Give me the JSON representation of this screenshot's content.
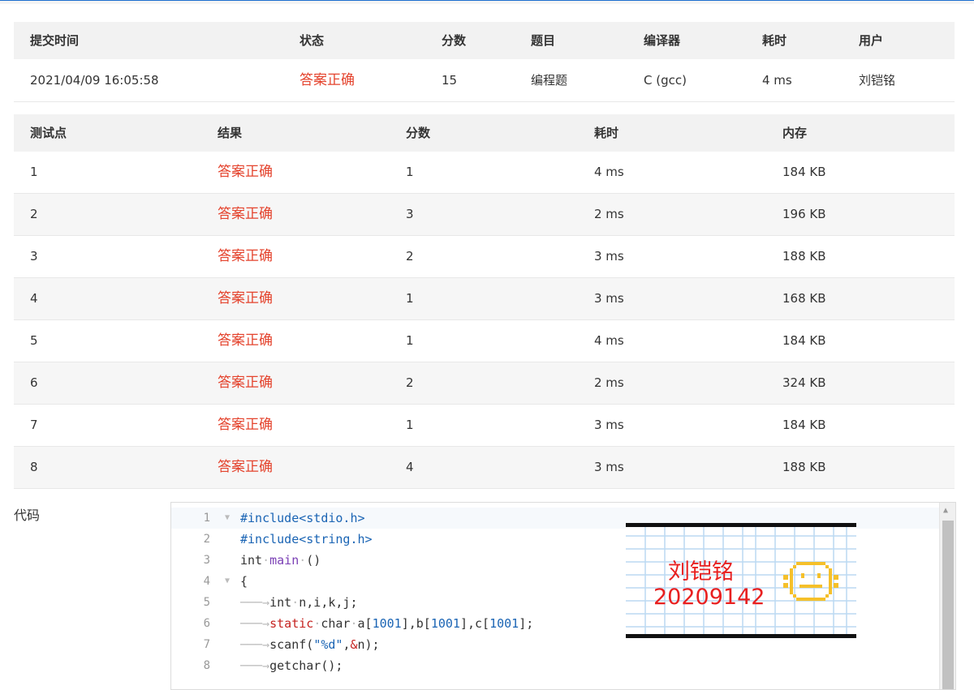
{
  "summary": {
    "headers": [
      "提交时间",
      "状态",
      "分数",
      "题目",
      "编译器",
      "耗时",
      "用户"
    ],
    "row": {
      "time": "2021/04/09 16:05:58",
      "status": "答案正确",
      "score": "15",
      "problem": "编程题",
      "compiler": "C (gcc)",
      "elapsed": "4 ms",
      "user": "刘铠铭"
    }
  },
  "cases": {
    "headers": [
      "测试点",
      "结果",
      "分数",
      "耗时",
      "内存"
    ],
    "rows": [
      {
        "id": "1",
        "result": "答案正确",
        "score": "1",
        "time": "4 ms",
        "memory": "184 KB"
      },
      {
        "id": "2",
        "result": "答案正确",
        "score": "3",
        "time": "2 ms",
        "memory": "196 KB"
      },
      {
        "id": "3",
        "result": "答案正确",
        "score": "2",
        "time": "3 ms",
        "memory": "188 KB"
      },
      {
        "id": "4",
        "result": "答案正确",
        "score": "1",
        "time": "3 ms",
        "memory": "168 KB"
      },
      {
        "id": "5",
        "result": "答案正确",
        "score": "1",
        "time": "4 ms",
        "memory": "184 KB"
      },
      {
        "id": "6",
        "result": "答案正确",
        "score": "2",
        "time": "2 ms",
        "memory": "324 KB"
      },
      {
        "id": "7",
        "result": "答案正确",
        "score": "1",
        "time": "3 ms",
        "memory": "184 KB"
      },
      {
        "id": "8",
        "result": "答案正确",
        "score": "4",
        "time": "3 ms",
        "memory": "188 KB"
      }
    ]
  },
  "code": {
    "label": "代码",
    "lines": [
      {
        "n": "1",
        "fold": true,
        "tokens": [
          {
            "t": "#include<stdio.h>",
            "c": "#1a64b4"
          }
        ]
      },
      {
        "n": "2",
        "fold": false,
        "tokens": [
          {
            "t": "#include<string.h>",
            "c": "#1a64b4"
          }
        ]
      },
      {
        "n": "3",
        "fold": false,
        "tokens": [
          {
            "t": "int",
            "c": "#333333"
          },
          {
            "t": "·",
            "c": "#bbbbbb"
          },
          {
            "t": "main",
            "c": "#7a3fb5"
          },
          {
            "t": "·",
            "c": "#bbbbbb"
          },
          {
            "t": "()",
            "c": "#333333"
          }
        ]
      },
      {
        "n": "4",
        "fold": true,
        "tokens": [
          {
            "t": "{",
            "c": "#333333"
          }
        ]
      },
      {
        "n": "5",
        "fold": false,
        "tokens": [
          {
            "t": "───→",
            "c": "#bbbbbb"
          },
          {
            "t": "int",
            "c": "#333333"
          },
          {
            "t": "·",
            "c": "#bbbbbb"
          },
          {
            "t": "n,i,k,j;",
            "c": "#333333"
          }
        ]
      },
      {
        "n": "6",
        "fold": false,
        "tokens": [
          {
            "t": "───→",
            "c": "#bbbbbb"
          },
          {
            "t": "static",
            "c": "#c5221f"
          },
          {
            "t": "·",
            "c": "#bbbbbb"
          },
          {
            "t": "char",
            "c": "#333333"
          },
          {
            "t": "·",
            "c": "#bbbbbb"
          },
          {
            "t": "a[",
            "c": "#333333"
          },
          {
            "t": "1001",
            "c": "#1a64b4"
          },
          {
            "t": "],b[",
            "c": "#333333"
          },
          {
            "t": "1001",
            "c": "#1a64b4"
          },
          {
            "t": "],c[",
            "c": "#333333"
          },
          {
            "t": "1001",
            "c": "#1a64b4"
          },
          {
            "t": "];",
            "c": "#333333"
          }
        ]
      },
      {
        "n": "7",
        "fold": false,
        "tokens": [
          {
            "t": "───→",
            "c": "#bbbbbb"
          },
          {
            "t": "scanf(",
            "c": "#333333"
          },
          {
            "t": "\"%d\"",
            "c": "#1a64b4"
          },
          {
            "t": ",",
            "c": "#333333"
          },
          {
            "t": "&",
            "c": "#c5221f"
          },
          {
            "t": "n);",
            "c": "#333333"
          }
        ]
      },
      {
        "n": "8",
        "fold": false,
        "tokens": [
          {
            "t": "───→",
            "c": "#bbbbbb"
          },
          {
            "t": "getchar();",
            "c": "#333333"
          }
        ]
      }
    ]
  },
  "watermark": {
    "name": "刘铠铭",
    "id": "20209142"
  }
}
